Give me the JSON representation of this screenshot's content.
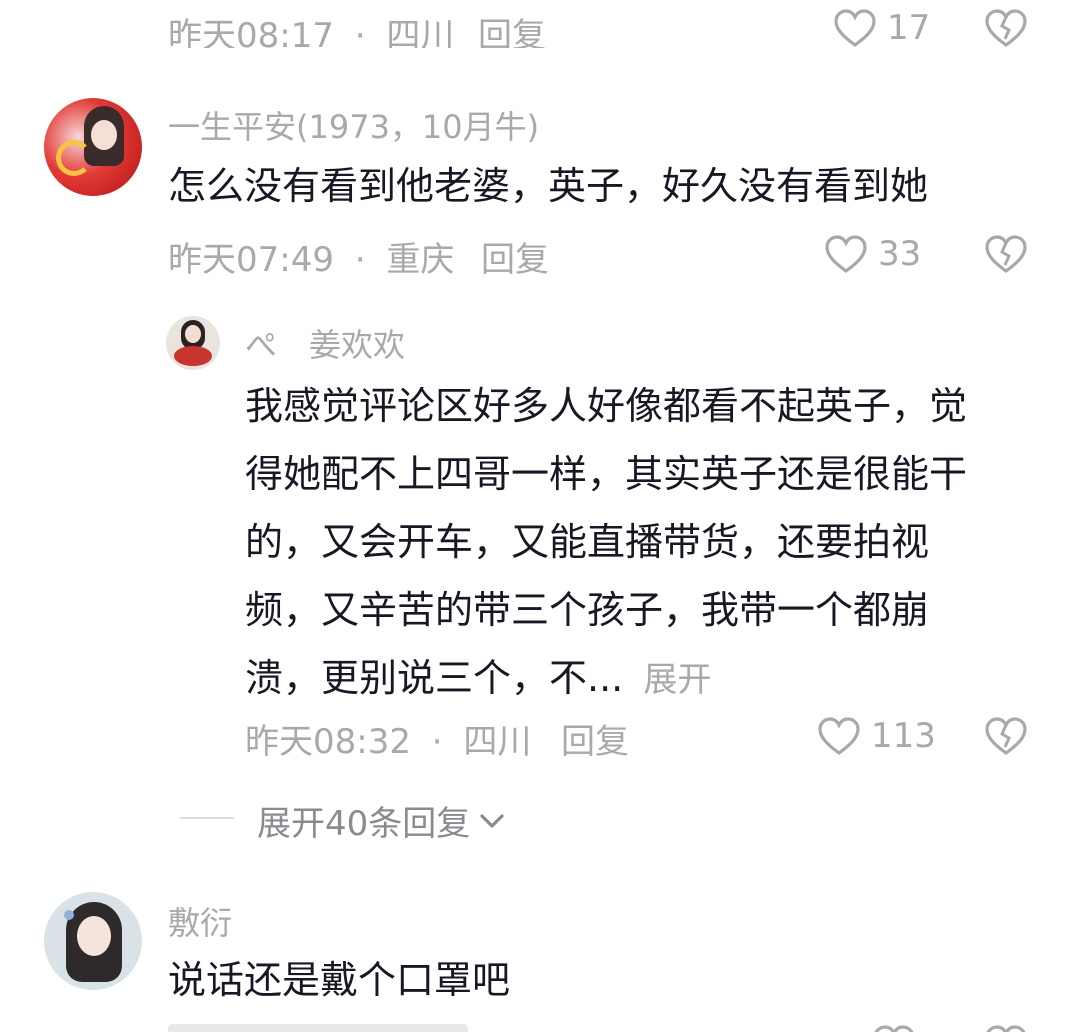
{
  "comments": [
    {
      "meta_time": "昨天08:17",
      "meta_sep": "·",
      "meta_location": "四川",
      "reply_label": "回复",
      "like_count": "17"
    },
    {
      "username": "一生平安(1973，10月牛)",
      "text": "怎么没有看到他老婆，英子，好久没有看到她",
      "meta_time": "昨天07:49",
      "meta_sep": "·",
      "meta_location": "重庆",
      "reply_label": "回复",
      "like_count": "33",
      "reply": {
        "username": "ぺ　姜欢欢",
        "text_lines": [
          "我感觉评论区好多人好像都看不起英子，觉",
          "得她配不上四哥一样，其实英子还是很能干",
          "的，又会开车，又能直播带货，还要拍视",
          "频，又辛苦的带三个孩子，我带一个都崩",
          "溃，更别说三个，不..."
        ],
        "expand_label": "展开",
        "meta_time": "昨天08:32",
        "meta_sep": "·",
        "meta_location": "四川",
        "reply_label": "回复",
        "like_count": "113"
      },
      "expand_replies_label": "展开40条回复"
    },
    {
      "username": "敷衍",
      "text": "说话还是戴个口罩吧"
    }
  ],
  "colors": {
    "primary_text": "#161823",
    "secondary_text": "#a8a8ad",
    "background": "#ffffff"
  },
  "icons": [
    "heart-icon",
    "dislike-heart-icon",
    "chevron-down-icon"
  ]
}
